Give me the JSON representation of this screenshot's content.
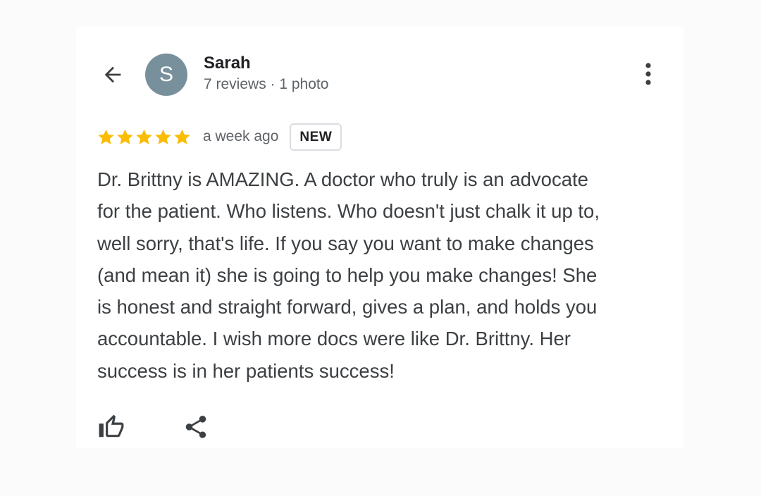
{
  "header": {
    "back_icon": "arrow-left-icon",
    "more_icon": "more-vertical-icon"
  },
  "reviewer": {
    "avatar_initial": "S",
    "avatar_color": "#78909c",
    "name": "Sarah",
    "meta": "7 reviews · 1 photo"
  },
  "review": {
    "rating": 5,
    "max_rating": 5,
    "star_color": "#fbbc04",
    "time_ago": "a week ago",
    "badge": "NEW",
    "text": "Dr. Brittny is AMAZING. A doctor who truly is an advocate\nfor the patient. Who listens. Who doesn't just chalk it up to,\nwell sorry, that's life. If you say you want to make changes\n(and mean it) she is going to help you make changes! She\nis honest and straight forward, gives a plan, and holds you\naccountable. I wish more docs were like Dr. Brittny. Her\nsuccess is in her patients success!"
  },
  "actions": {
    "like_icon": "thumbs-up-icon",
    "share_icon": "share-icon"
  }
}
